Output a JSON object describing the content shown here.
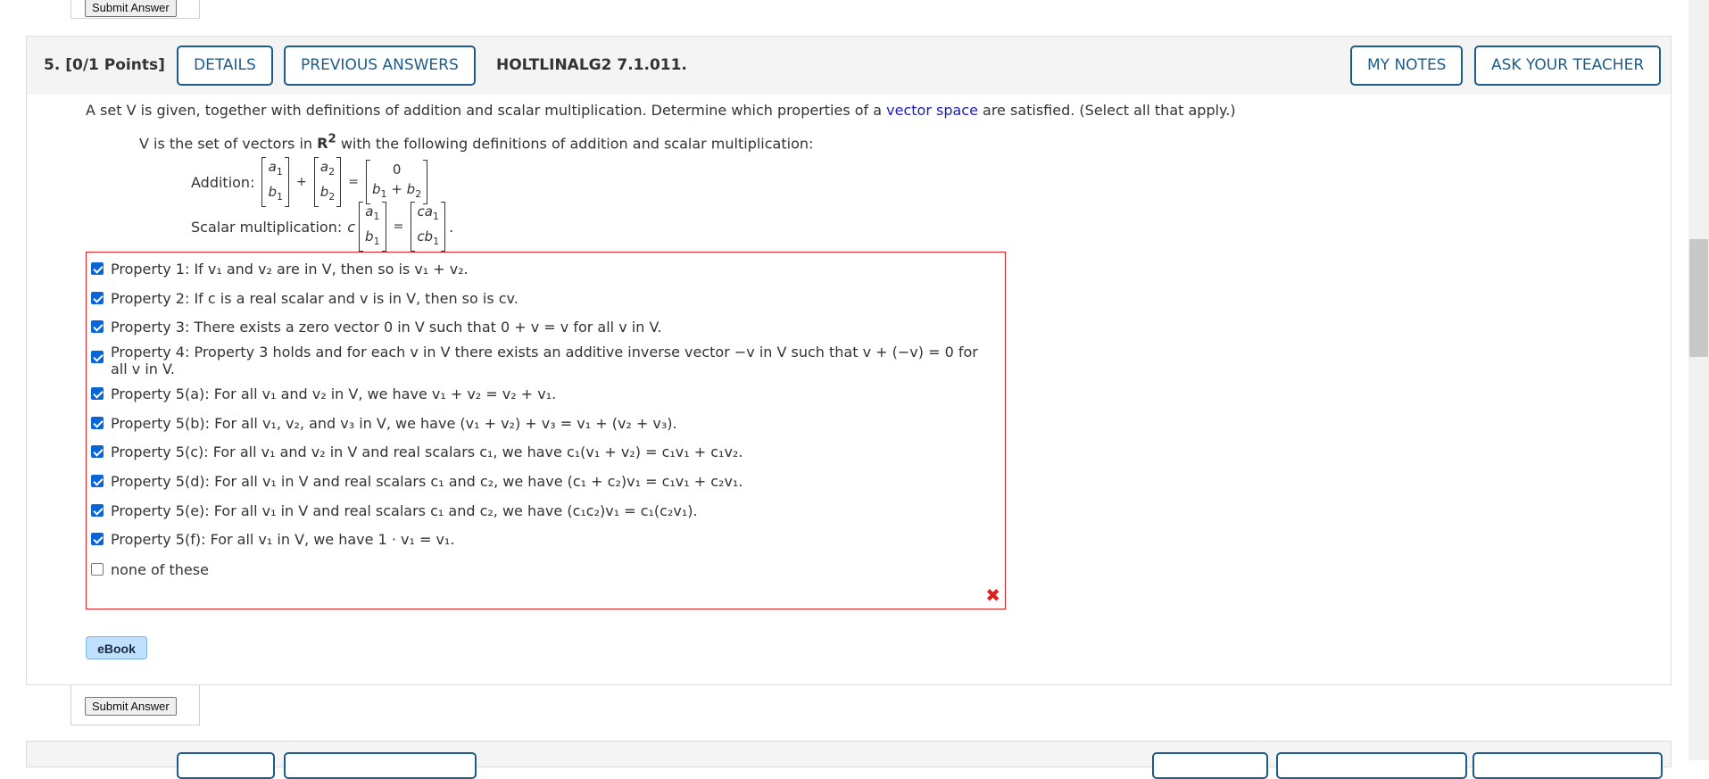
{
  "prev_question": {
    "submit_label": "Submit Answer"
  },
  "header": {
    "number": "5.",
    "points": "[0/1 Points]",
    "details_label": "DETAILS",
    "previous_answers_label": "PREVIOUS ANSWERS",
    "code": "HOLTLINALG2 7.1.011.",
    "my_notes_label": "MY NOTES",
    "ask_teacher_label": "ASK YOUR TEACHER"
  },
  "question": {
    "intro_pre": "A set V is given, together with definitions of addition and scalar multiplication. Determine which properties of a ",
    "intro_link": "vector space",
    "intro_post": " are satisfied. (Select all that apply.)",
    "vdef_pre": "V is the set of vectors in ",
    "vdef_post": " with the following definitions of addition and scalar multiplication:",
    "addition_label": "Addition:",
    "scalar_label": "Scalar multiplication:"
  },
  "options": [
    {
      "checked": true,
      "text": "Property 1: If v₁ and v₂ are in V, then so is v₁ + v₂."
    },
    {
      "checked": true,
      "text": "Property 2: If c is a real scalar and v is in V, then so is cv."
    },
    {
      "checked": true,
      "text": "Property 3: There exists a zero vector 0 in V such that 0 + v = v for all v in V."
    },
    {
      "checked": true,
      "text": "Property 4: Property 3 holds and for each v in V there exists an additive inverse vector −v in V such that v + (−v) = 0 for all v in V."
    },
    {
      "checked": true,
      "text": "Property 5(a): For all v₁ and v₂ in V, we have v₁ + v₂ = v₂ + v₁."
    },
    {
      "checked": true,
      "text": "Property 5(b): For all v₁, v₂, and v₃ in V, we have (v₁ + v₂) + v₃ = v₁ + (v₂ + v₃)."
    },
    {
      "checked": true,
      "text": "Property 5(c): For all v₁ and v₂ in V and real scalars c₁, we have c₁(v₁ + v₂) = c₁v₁ + c₁v₂."
    },
    {
      "checked": true,
      "text": "Property 5(d): For all v₁ in V and real scalars c₁ and c₂, we have (c₁ + c₂)v₁ = c₁v₁ + c₂v₁."
    },
    {
      "checked": true,
      "text": "Property 5(e): For all v₁ in V and real scalars c₁ and c₂, we have (c₁c₂)v₁ = c₁(c₂v₁)."
    },
    {
      "checked": true,
      "text": "Property 5(f): For all v₁ in V, we have 1 · v₁ = v₁."
    },
    {
      "checked": false,
      "text": "none of these"
    }
  ],
  "status": {
    "mark": "✖",
    "color": "#e02020"
  },
  "ebook_label": "eBook",
  "submit_label": "Submit Answer",
  "colors": {
    "accent": "#1d5c88",
    "link": "#1b1bb8",
    "error": "#e02020",
    "checkbox": "#0a66d6"
  }
}
